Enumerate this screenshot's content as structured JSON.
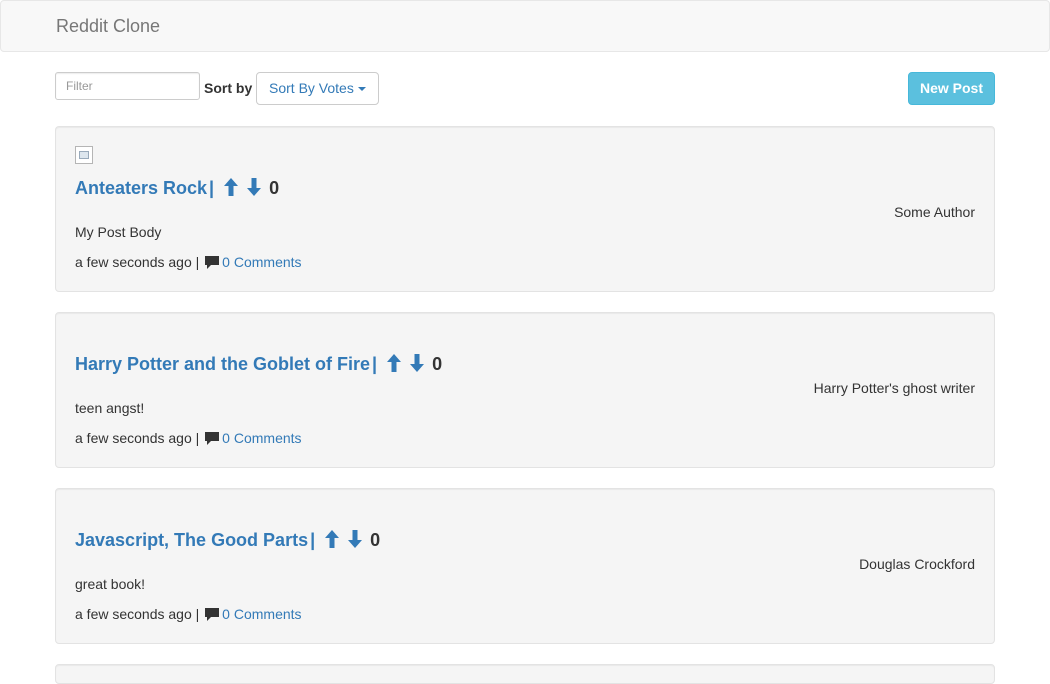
{
  "navbar": {
    "brand": "Reddit Clone"
  },
  "toolbar": {
    "filter_placeholder": "Filter",
    "filter_value": "",
    "sort_label": "Sort by",
    "sort_selected": "Sort By Votes",
    "new_post_label": "New Post"
  },
  "posts": [
    {
      "title": "Anteaters Rock",
      "votes": "0",
      "author": "Some Author",
      "body": "My Post Body",
      "time": "a few seconds ago",
      "comments": "0 Comments"
    },
    {
      "title": "Harry Potter and the Goblet of Fire",
      "votes": "0",
      "author": "Harry Potter's ghost writer",
      "body": "teen angst!",
      "time": "a few seconds ago",
      "comments": "0 Comments"
    },
    {
      "title": "Javascript, The Good Parts",
      "votes": "0",
      "author": "Douglas Crockford",
      "body": "great book!",
      "time": "a few seconds ago",
      "comments": "0 Comments"
    }
  ],
  "separators": {
    "title_pipe": "|",
    "meta_pipe": "|"
  },
  "icons": {
    "upvote": "arrow-up-icon",
    "downvote": "arrow-down-icon",
    "comment": "comment-icon",
    "thumbnail": "broken-image-icon",
    "caret": "caret-down-icon"
  },
  "colors": {
    "link": "#337ab7",
    "info_button": "#5bc0de",
    "card_bg": "#f5f5f5",
    "navbar_bg": "#f8f8f8"
  }
}
